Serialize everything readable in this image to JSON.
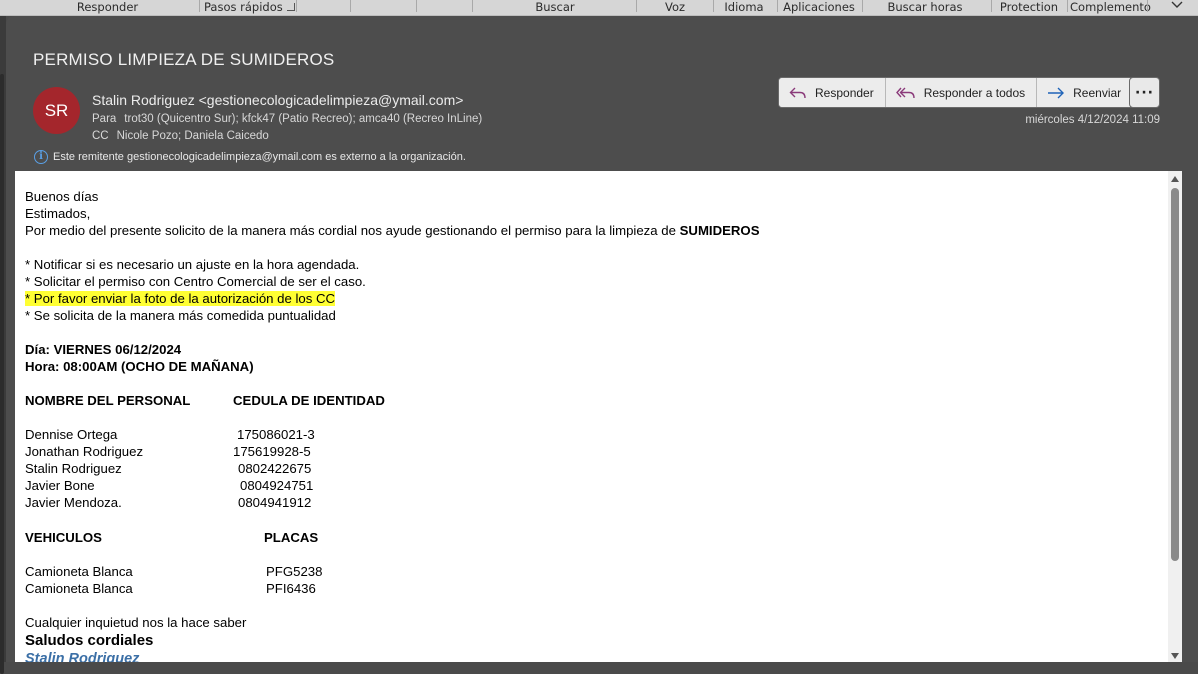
{
  "ribbon": {
    "groups": [
      "Responder",
      "Pasos rápidos",
      "Buscar",
      "Voz",
      "Idioma",
      "Aplicaciones",
      "Buscar horas",
      "Protection",
      "Complemento"
    ]
  },
  "email": {
    "subject": "PERMISO LIMPIEZA DE SUMIDEROS",
    "avatar_initials": "SR",
    "avatar_color": "#a4262c",
    "sender": "Stalin Rodriguez <gestionecologicadelimpieza@ymail.com>",
    "to_label": "Para",
    "to": "trot30 (Quicentro Sur); kfck47 (Patio Recreo); amca40 (Recreo InLine)",
    "cc_label": "CC",
    "cc": "Nicole Pozo; Daniela Caicedo",
    "external_notice": "Este remitente gestionecologicadelimpieza@ymail.com es externo a la organización.",
    "datetime": "miércoles 4/12/2024 11:09",
    "actions": {
      "reply": "Responder",
      "reply_all": "Responder a todos",
      "forward": "Reenviar",
      "more": "···"
    }
  },
  "body": {
    "greeting": "Buenos días",
    "salutation": "Estimados,",
    "intro": "Por medio del presente solicito de la manera más cordial nos ayude gestionando el permiso para la limpieza de ",
    "intro_bold": "SUMIDEROS",
    "bullets": [
      "* Notificar si es necesario un ajuste en la hora agendada.",
      "* Solicitar el permiso con Centro Comercial de ser el caso.",
      "* Por favor enviar la foto de la autorización de los CC",
      "* Se solicita de la manera más comedida puntualidad"
    ],
    "day": "Día: VIERNES 06/12/2024",
    "hour": "Hora: 08:00AM (OCHO DE MAÑANA)",
    "personnel_headers": [
      "NOMBRE DEL PERSONAL",
      "CEDULA DE IDENTIDAD"
    ],
    "personnel": [
      {
        "name": "Dennise Ortega",
        "id": "175086021-3"
      },
      {
        "name": "Jonathan Rodriguez",
        "id": "175619928-5"
      },
      {
        "name": "Stalin Rodriguez",
        "id": "0802422675"
      },
      {
        "name": "Javier Bone",
        "id": "0804924751"
      },
      {
        "name": "Javier Mendoza.",
        "id": "0804941912"
      }
    ],
    "vehicle_headers": [
      "VEHICULOS",
      "PLACAS"
    ],
    "vehicles": [
      {
        "type": "Camioneta  Blanca",
        "plate": "PFG5238"
      },
      {
        "type": "Camioneta Blanca",
        "plate": "PFI6436"
      }
    ],
    "closing": "Cualquier inquietud nos la hace saber",
    "signoff": "Saludos cordiales",
    "signature": "Stalin Rodriguez"
  }
}
